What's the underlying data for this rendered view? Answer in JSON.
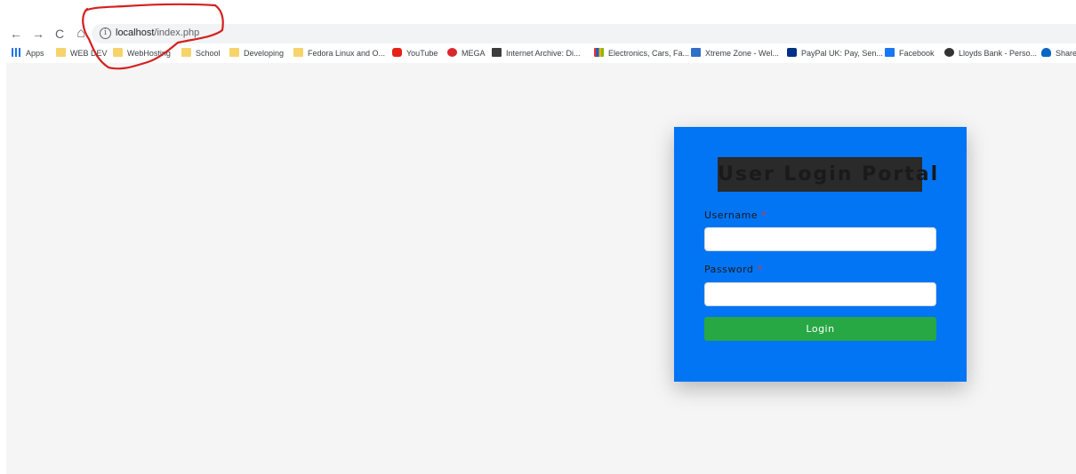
{
  "browser": {
    "url_host": "localhost",
    "url_path": "/index.php",
    "nav": {
      "back": "←",
      "forward": "→",
      "reload": "C",
      "home": "⌂",
      "info": "i"
    }
  },
  "bookmarks": [
    {
      "label": "Apps",
      "icon": "apps-icon"
    },
    {
      "label": "WEB DEV",
      "icon": "folder-icon"
    },
    {
      "label": "WebHosting",
      "icon": "folder-icon"
    },
    {
      "label": "School",
      "icon": "folder-icon"
    },
    {
      "label": "Developing",
      "icon": "folder-icon"
    },
    {
      "label": "Fedora Linux and O...",
      "icon": "folder-icon"
    },
    {
      "label": "YouTube",
      "icon": "youtube-icon"
    },
    {
      "label": "MEGA",
      "icon": "mega-icon"
    },
    {
      "label": "Internet Archive: Di...",
      "icon": "internet-archive-icon"
    },
    {
      "label": "Electronics, Cars, Fa...",
      "icon": "ebay-icon"
    },
    {
      "label": "Xtreme Zone - Wel...",
      "icon": "xtreme-zone-icon"
    },
    {
      "label": "PayPal UK: Pay, Sen...",
      "icon": "paypal-icon"
    },
    {
      "label": "Facebook",
      "icon": "facebook-icon"
    },
    {
      "label": "Lloyds Bank - Perso...",
      "icon": "lloyds-icon"
    },
    {
      "label": "Share",
      "icon": "cloud-icon"
    }
  ],
  "login": {
    "title": "User Login Portal",
    "username_label": "Username",
    "password_label": "Password",
    "required_mark": "*",
    "username_value": "",
    "password_value": "",
    "button_label": "Login"
  },
  "colors": {
    "card": "#0275f5",
    "button": "#28a745",
    "page_bg": "#f5f5f5",
    "annotation": "#d42020"
  }
}
